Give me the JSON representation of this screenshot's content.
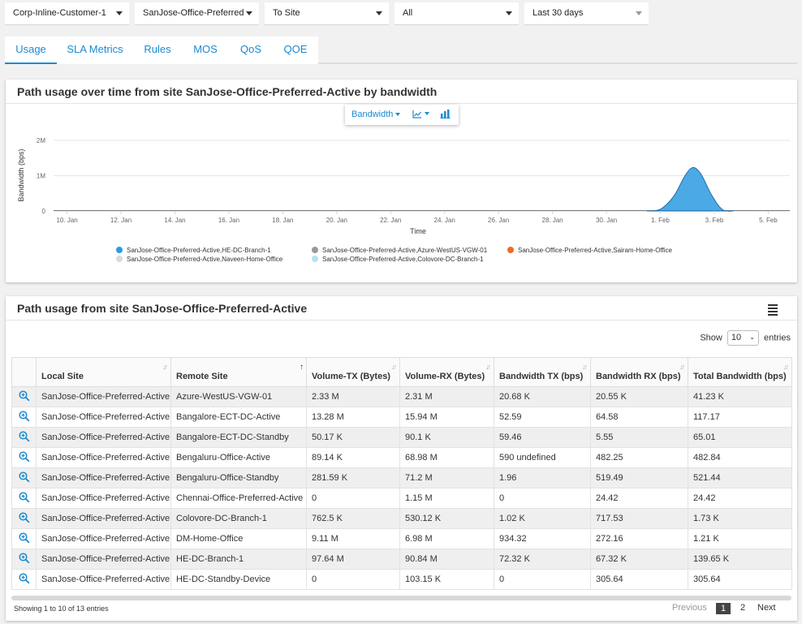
{
  "filters": [
    {
      "name": "customer",
      "value": "Corp-Inline-Customer-1"
    },
    {
      "name": "site",
      "value": "SanJose-Office-Preferred"
    },
    {
      "name": "direction",
      "value": "To Site"
    },
    {
      "name": "scope",
      "value": "All"
    },
    {
      "name": "time-range",
      "value": "Last 30 days"
    }
  ],
  "tabs": [
    {
      "label": "Usage",
      "active": true
    },
    {
      "label": "SLA Metrics",
      "active": false
    },
    {
      "label": "Rules",
      "active": false
    },
    {
      "label": "MOS",
      "active": false
    },
    {
      "label": "QoS",
      "active": false
    },
    {
      "label": "QOE",
      "active": false
    }
  ],
  "chart_card": {
    "title": "Path usage over time from site SanJose-Office-Preferred-Active by bandwidth",
    "toolbar": {
      "metric_label": "Bandwidth",
      "chart_type_icon": "area-chart-icon",
      "bar_icon": "bar-chart-icon"
    }
  },
  "chart_data": {
    "type": "area",
    "title": "Path usage over time from site SanJose-Office-Preferred-Active by bandwidth",
    "xlabel": "Time",
    "ylabel": "Bandwidth (bps)",
    "x_ticks": [
      "10. Jan",
      "12. Jan",
      "14. Jan",
      "16. Jan",
      "18. Jan",
      "20. Jan",
      "22. Jan",
      "24. Jan",
      "26. Jan",
      "28. Jan",
      "30. Jan",
      "1. Feb",
      "3. Feb",
      "5. Feb"
    ],
    "y_ticks": [
      "0",
      "1M",
      "2M"
    ],
    "ylim": [
      0,
      2000000
    ],
    "xlim_days": [
      -0.5,
      26.8
    ],
    "grid": true,
    "legend_placement": "bottom",
    "series": [
      {
        "name": "SanJose-Office-Preferred-Active,HE-DC-Branch-1",
        "color": "#2b9be0",
        "x_days": [
          21.5,
          22.0,
          22.5,
          22.9,
          23.2,
          23.5,
          23.9,
          24.3,
          24.7
        ],
        "values": [
          0,
          50000,
          420000,
          980000,
          1230000,
          1050000,
          450000,
          40000,
          0
        ]
      },
      {
        "name": "SanJose-Office-Preferred-Active,Azure-WestUS-VGW-01",
        "color": "#999999",
        "x_days": [],
        "values": []
      },
      {
        "name": "SanJose-Office-Preferred-Active,Sairam-Home-Office",
        "color": "#f26a24",
        "x_days": [],
        "values": []
      },
      {
        "name": "SanJose-Office-Preferred-Active,Naveen-Home-Office",
        "color": "#d9d9d9",
        "x_days": [],
        "values": []
      },
      {
        "name": "SanJose-Office-Preferred-Active,Colovore-DC-Branch-1",
        "color": "#b8e0f5",
        "x_days": [],
        "values": []
      }
    ]
  },
  "table_card": {
    "title": "Path usage from site SanJose-Office-Preferred-Active",
    "show_label": "Show",
    "page_size": "10",
    "entries_label": "entries",
    "columns": [
      "",
      "Local Site",
      "Remote Site",
      "Volume-TX (Bytes)",
      "Volume-RX (Bytes)",
      "Bandwidth TX (bps)",
      "Bandwidth RX (bps)",
      "Total Bandwidth (bps)"
    ],
    "sorted_column": "Remote Site",
    "rows": [
      [
        "SanJose-Office-Preferred-Active",
        "Azure-WestUS-VGW-01",
        "2.33 M",
        "2.31 M",
        "20.68 K",
        "20.55 K",
        "41.23 K"
      ],
      [
        "SanJose-Office-Preferred-Active",
        "Bangalore-ECT-DC-Active",
        "13.28 M",
        "15.94 M",
        "52.59",
        "64.58",
        "117.17"
      ],
      [
        "SanJose-Office-Preferred-Active",
        "Bangalore-ECT-DC-Standby",
        "50.17 K",
        "90.1 K",
        "59.46",
        "5.55",
        "65.01"
      ],
      [
        "SanJose-Office-Preferred-Active",
        "Bengaluru-Office-Active",
        "89.14 K",
        "68.98 M",
        "590 undefined",
        "482.25",
        "482.84"
      ],
      [
        "SanJose-Office-Preferred-Active",
        "Bengaluru-Office-Standby",
        "281.59 K",
        "71.2 M",
        "1.96",
        "519.49",
        "521.44"
      ],
      [
        "SanJose-Office-Preferred-Active",
        "Chennai-Office-Preferred-Active",
        "0",
        "1.15 M",
        "0",
        "24.42",
        "24.42"
      ],
      [
        "SanJose-Office-Preferred-Active",
        "Colovore-DC-Branch-1",
        "762.5 K",
        "530.12 K",
        "1.02 K",
        "717.53",
        "1.73 K"
      ],
      [
        "SanJose-Office-Preferred-Active",
        "DM-Home-Office",
        "9.11 M",
        "6.98 M",
        "934.32",
        "272.16",
        "1.21 K"
      ],
      [
        "SanJose-Office-Preferred-Active",
        "HE-DC-Branch-1",
        "97.64 M",
        "90.84 M",
        "72.32 K",
        "67.32 K",
        "139.65 K"
      ],
      [
        "SanJose-Office-Preferred-Active",
        "HE-DC-Standby-Device",
        "0",
        "103.15 K",
        "0",
        "305.64",
        "305.64"
      ]
    ],
    "footer": {
      "info": "Showing 1 to 10 of 13 entries",
      "previous": "Previous",
      "pages": [
        "1",
        "2"
      ],
      "current_page": "1",
      "next": "Next"
    }
  }
}
